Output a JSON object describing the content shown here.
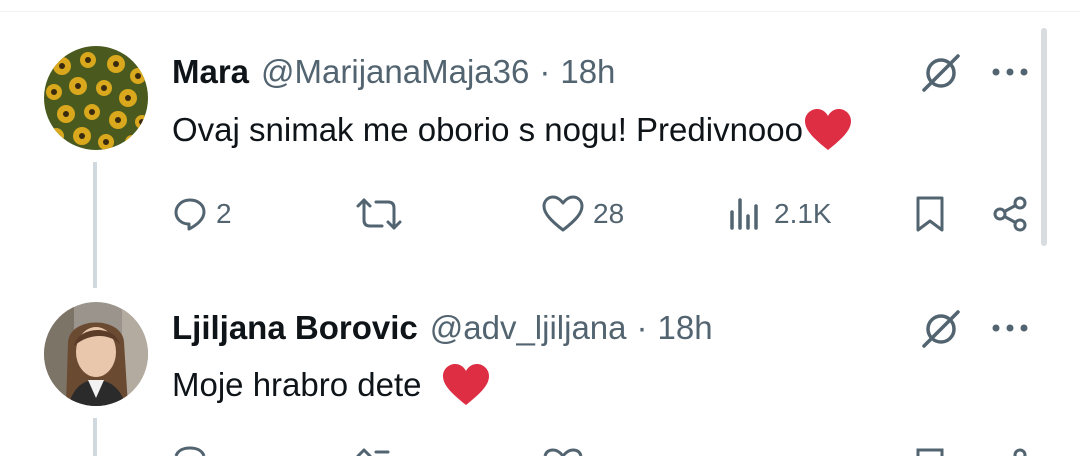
{
  "replies": [
    {
      "name": "Mara",
      "handle": "@MarijanaMaja36",
      "separator": "·",
      "time": "18h",
      "text": "Ovaj snimak me oborio s nogu! Predivnooo",
      "emoji": "heart-emoji",
      "actions": {
        "replies": "2",
        "retweets": "",
        "likes": "28",
        "views": "2.1K"
      }
    },
    {
      "name": "Ljiljana Borovic",
      "handle": "@adv_ljiljana",
      "separator": "·",
      "time": "18h",
      "text": "Moje hrabro dete",
      "emoji": "heart-emoji"
    }
  ],
  "colors": {
    "text": "#0f1419",
    "secondary": "#536471",
    "heart": "#dd2e44",
    "thread_line": "#cfd9de"
  }
}
